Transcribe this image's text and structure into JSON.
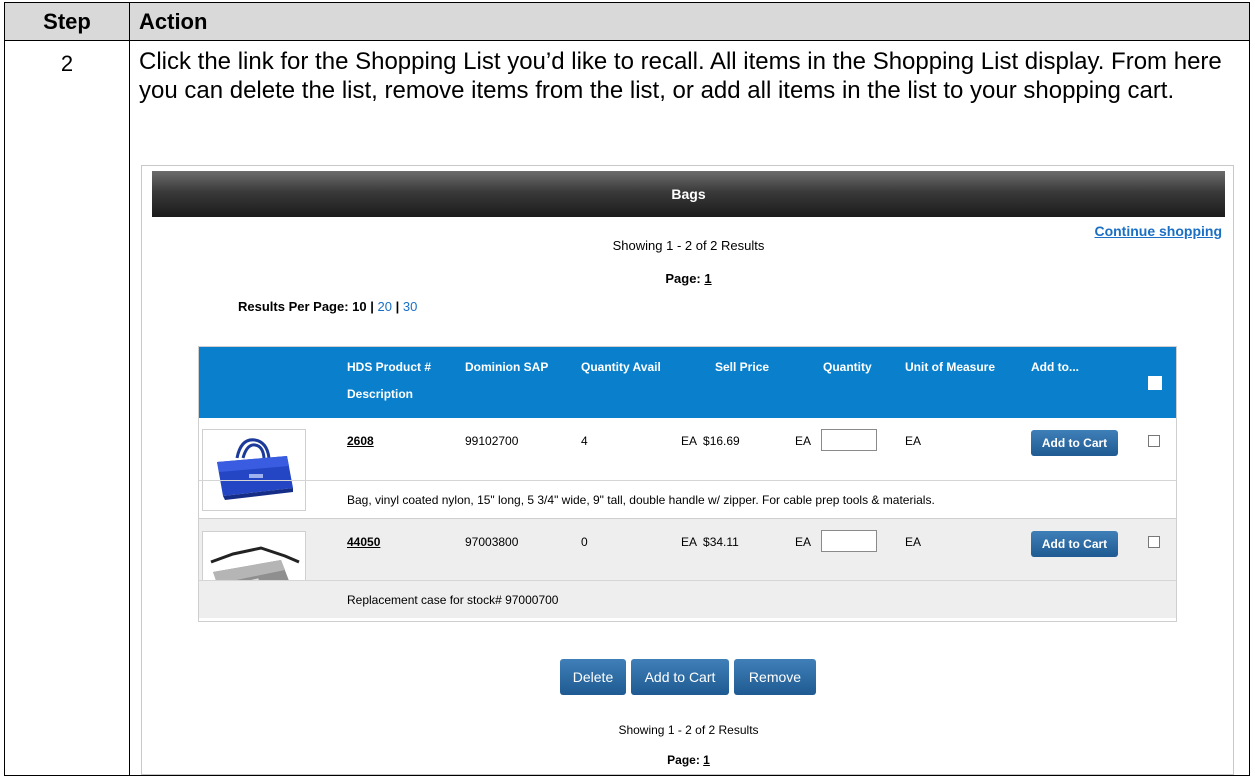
{
  "doc": {
    "header_step": "Step",
    "header_action": "Action",
    "step_number": "2",
    "step_text": "Click the link for the Shopping List you’d like to recall. All items in the Shopping List display. From here you can delete the list, remove items from the list, or add all items in the list to your shopping cart."
  },
  "screen": {
    "title": "Bags",
    "continue_shopping": "Continue shopping",
    "showing_top": "Showing 1 - 2 of 2 Results",
    "page_label": "Page:",
    "page_number": "1",
    "results_per_page_label": "Results Per Page:",
    "rpp_current": "10",
    "rpp_sep": "|",
    "rpp_option_20": "20",
    "rpp_option_30": "30",
    "columns": {
      "product": "HDS Product #",
      "description": "Description",
      "sap": "Dominion SAP",
      "avail": "Quantity Avail",
      "price": "Sell Price",
      "quantity": "Quantity",
      "uom": "Unit of Measure",
      "add_to": "Add to..."
    },
    "items": [
      {
        "product": "2608",
        "sap": "99102700",
        "avail": "4",
        "price": "EA  $16.69",
        "qty_unit": "EA",
        "uom": "EA",
        "button": "Add to Cart",
        "description": "Bag, vinyl coated nylon, 15\" long, 5 3/4\" wide, 9\" tall, double handle w/ zipper. For cable prep tools & materials."
      },
      {
        "product": "44050",
        "sap": "97003800",
        "avail": "0",
        "price": "EA  $34.11",
        "qty_unit": "EA",
        "uom": "EA",
        "button": "Add to Cart",
        "description": "Replacement case for stock# 97000700"
      }
    ],
    "actions": {
      "delete": "Delete",
      "add_to_cart": "Add to Cart",
      "remove": "Remove"
    },
    "showing_bottom": "Showing 1 - 2 of 2 Results",
    "colors": {
      "header_blue": "#0a80cc",
      "button_blue": "#1f5a92",
      "link_blue": "#1a6fc4"
    }
  }
}
